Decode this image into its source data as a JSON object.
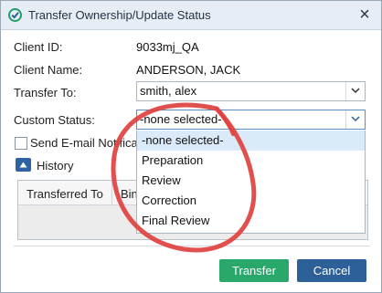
{
  "dialog": {
    "title": "Transfer Ownership/Update Status",
    "close_glyph": "×",
    "icon": "check-circle-icon"
  },
  "form": {
    "client_id_label": "Client ID:",
    "client_id_value": "9033mj_QA",
    "client_name_label": "Client Name:",
    "client_name_value": "ANDERSON, JACK",
    "transfer_to_label": "Transfer To:",
    "transfer_to_value": "smith, alex",
    "custom_status_label": "Custom Status:",
    "custom_status_value": "-none selected-",
    "send_email_label": "Send E-mail Notification",
    "send_email_checked": false
  },
  "history": {
    "label": "History",
    "columns": [
      "Transferred To",
      "Binder"
    ]
  },
  "dropdown": {
    "options": [
      "-none selected-",
      "Preparation",
      "Review",
      "Correction",
      "Final Review"
    ],
    "selected": "-none selected-"
  },
  "buttons": {
    "transfer": "Transfer",
    "cancel": "Cancel"
  },
  "colors": {
    "transfer_button": "#2aa76b",
    "cancel_button": "#2d5f99",
    "annotation": "#e0413f",
    "selected_option": "#dbeaf8"
  }
}
